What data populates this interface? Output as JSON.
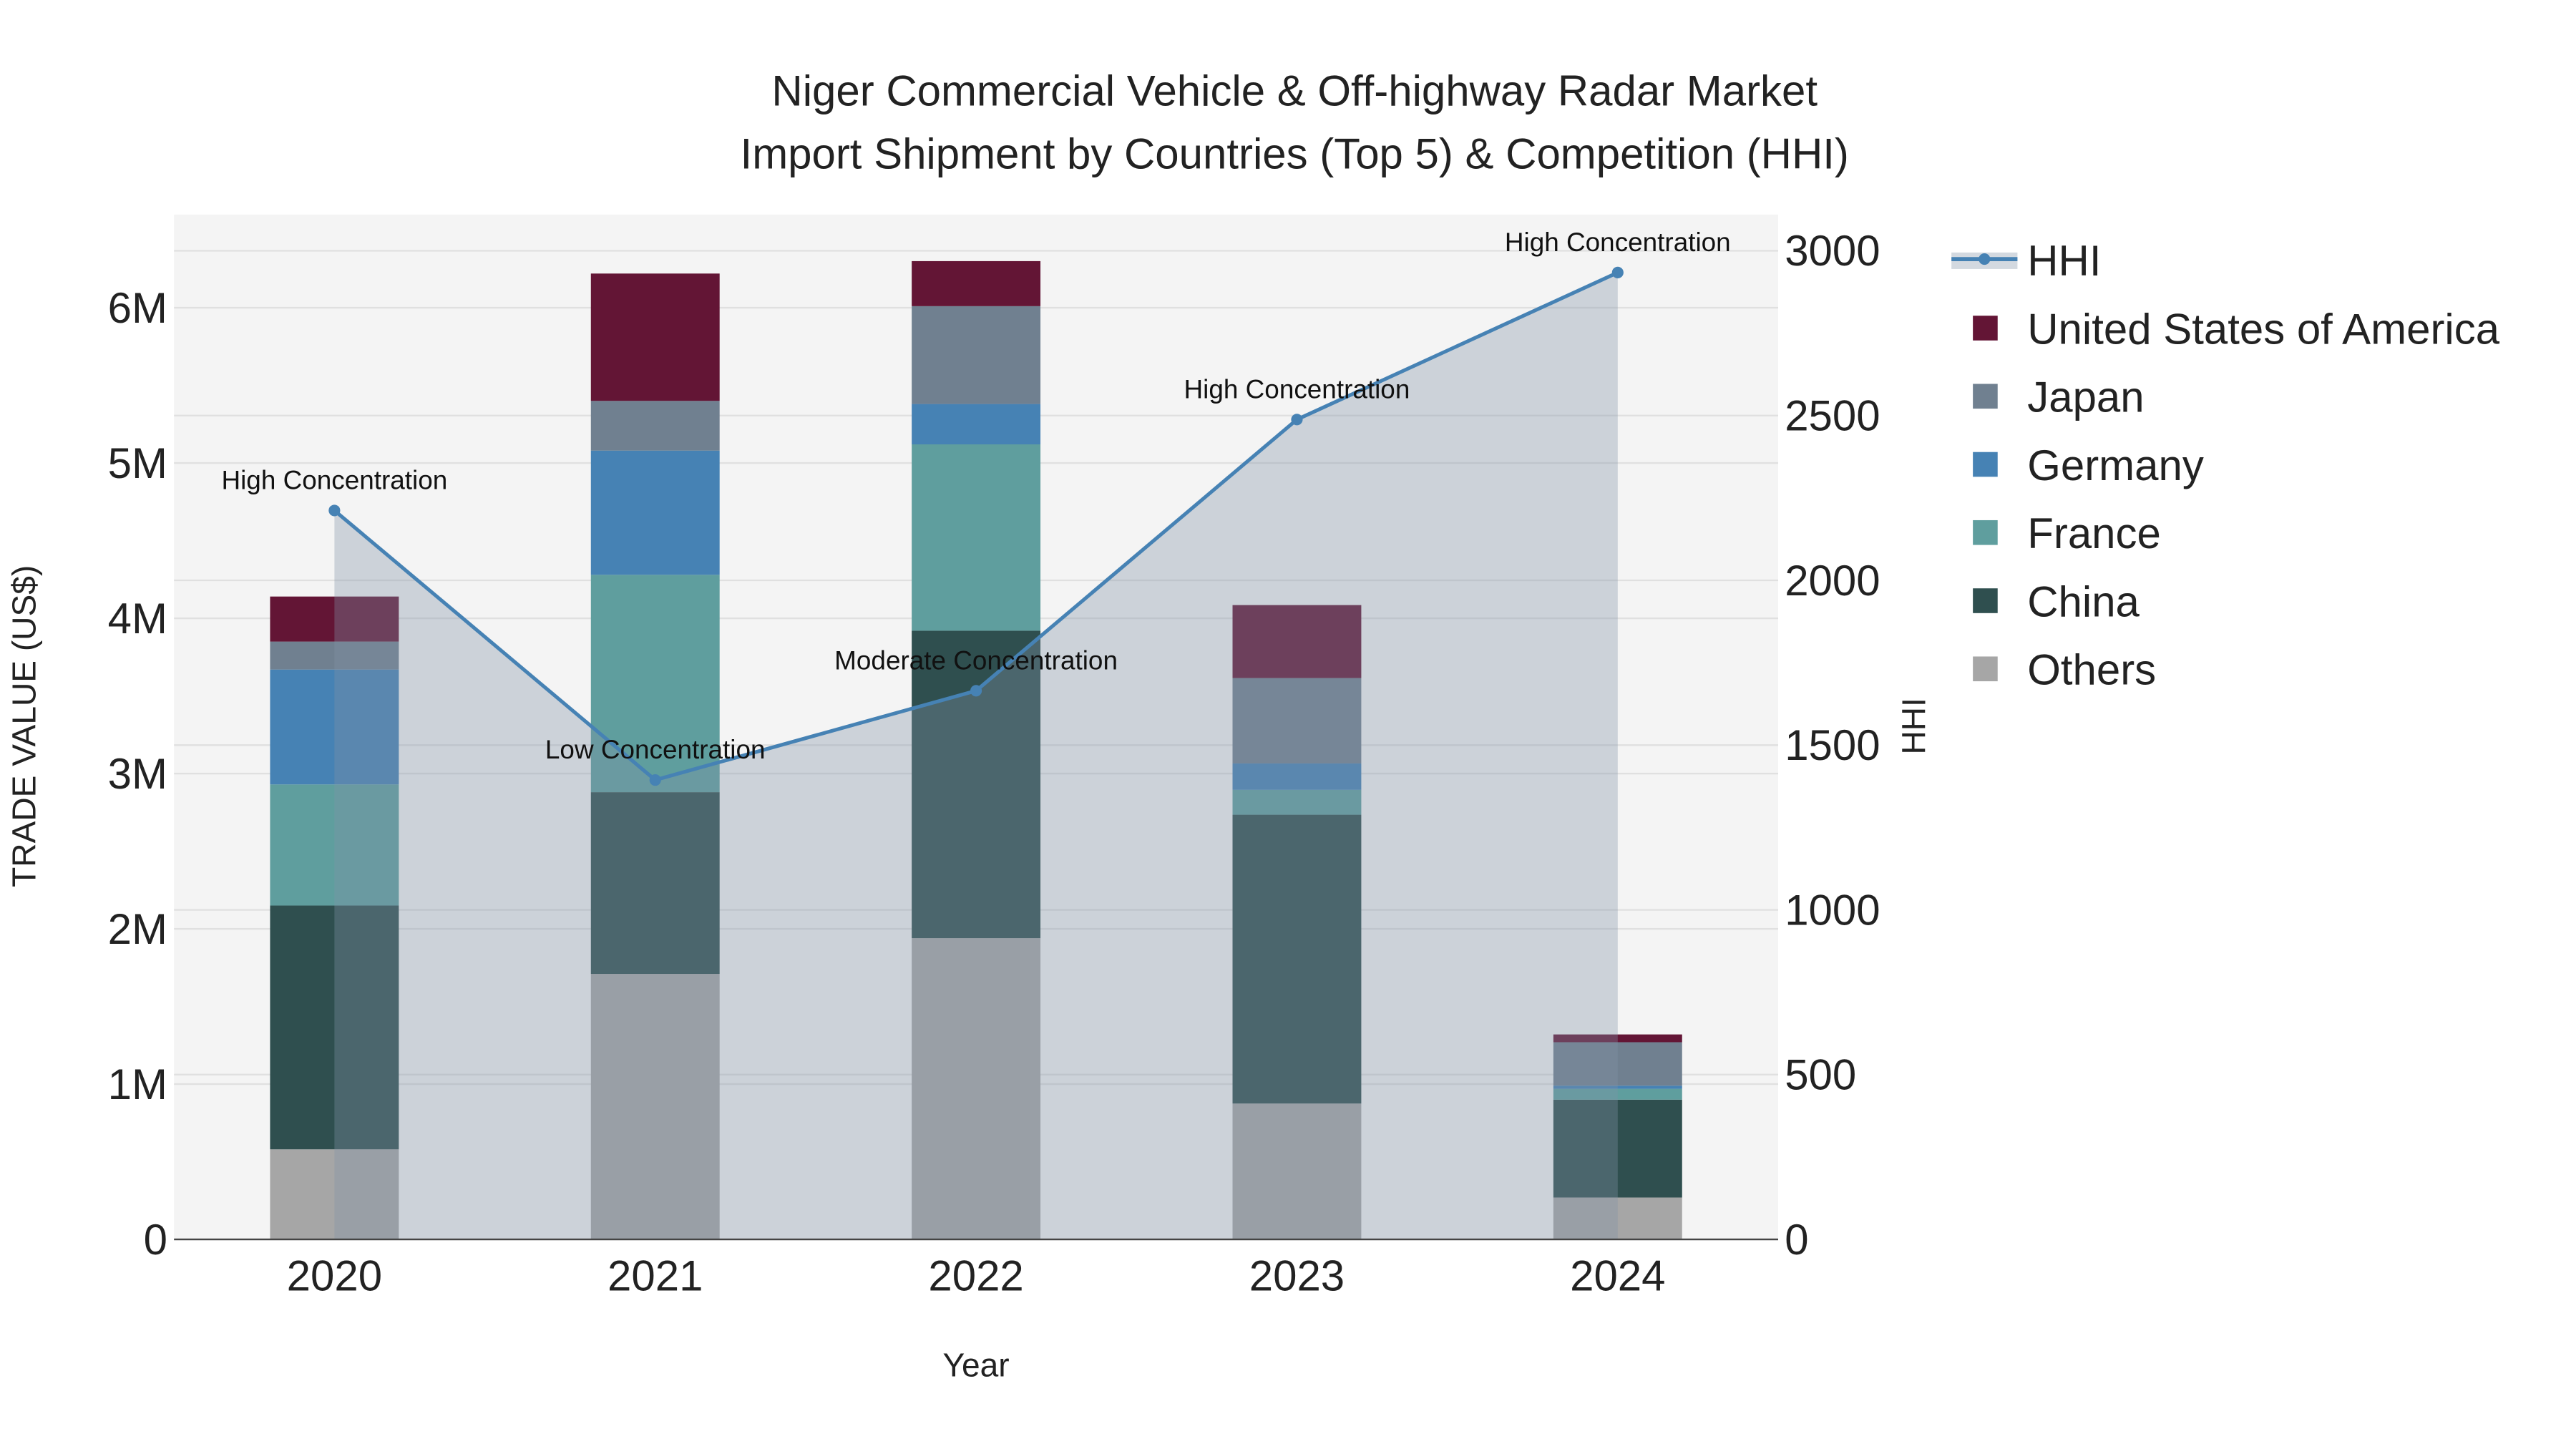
{
  "chart_data": {
    "type": "bar",
    "title_line1": "Niger Commercial Vehicle & Off-highway Radar Market",
    "title_line2": "Import Shipment by Countries (Top 5) & Competition (HHI)",
    "xlabel": "Year",
    "ylabel": "TRADE VALUE (US$)",
    "y2label": "HHI",
    "categories": [
      "2020",
      "2021",
      "2022",
      "2023",
      "2024"
    ],
    "ylim": [
      0,
      6600000
    ],
    "y_ticks": [
      0,
      1000000,
      2000000,
      3000000,
      4000000,
      5000000,
      6000000
    ],
    "y_tick_labels": [
      "0",
      "1M",
      "2M",
      "3M",
      "4M",
      "5M",
      "6M"
    ],
    "y2lim": [
      0,
      3110
    ],
    "y2_ticks": [
      0,
      500,
      1000,
      1500,
      2000,
      2500,
      3000
    ],
    "y2_tick_labels": [
      "0",
      "500",
      "1000",
      "1500",
      "2000",
      "2500",
      "3000"
    ],
    "stacked": true,
    "series": [
      {
        "name": "Others",
        "color": "#a6a6a6",
        "values": [
          580000,
          1710000,
          1940000,
          875000,
          270000
        ]
      },
      {
        "name": "China",
        "color": "#2f4f4f",
        "values": [
          1570000,
          1170000,
          1980000,
          1860000,
          630000
        ]
      },
      {
        "name": "France",
        "color": "#5f9e9e",
        "values": [
          780000,
          1400000,
          1200000,
          160000,
          70000
        ]
      },
      {
        "name": "Germany",
        "color": "#4682b4",
        "values": [
          740000,
          800000,
          260000,
          170000,
          20000
        ]
      },
      {
        "name": "Japan",
        "color": "#708090",
        "values": [
          180000,
          320000,
          630000,
          550000,
          280000
        ]
      },
      {
        "name": "United States of America",
        "color": "#631535",
        "values": [
          290000,
          820000,
          290000,
          470000,
          50000
        ]
      }
    ],
    "line": {
      "name": "HHI",
      "color": "#4682b4",
      "axis": "right",
      "values": [
        2212,
        1394,
        1665,
        2488,
        2934
      ],
      "annotations": [
        "High Concentration",
        "Low Concentration",
        "Moderate Concentration",
        "High Concentration",
        "High Concentration"
      ]
    },
    "legend_order": [
      "HHI",
      "United States of America",
      "Japan",
      "Germany",
      "France",
      "China",
      "Others"
    ],
    "legend_placement": "right",
    "grid": true
  }
}
